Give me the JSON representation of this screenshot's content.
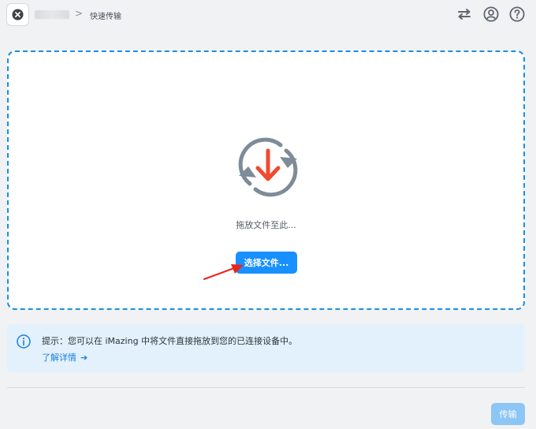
{
  "header": {
    "breadcrumb_separator": ">",
    "page_title": "快速传输",
    "icons": [
      "close-icon",
      "transfer-arrows-icon",
      "account-icon",
      "help-icon"
    ]
  },
  "drop_zone": {
    "hint": "拖放文件至此...",
    "choose_button_label": "选择文件...",
    "border_color": "#1a8fe3",
    "icon_colors": {
      "arrow": "#f04a2e",
      "ring": "#7e8b98"
    }
  },
  "tip": {
    "text": "提示：您可以在 iMazing 中将文件直接拖放到您的已连接设备中。",
    "link_label": "了解详情",
    "link_arrow": "➔"
  },
  "footer": {
    "transfer_button_label": "传输"
  },
  "colors": {
    "accent": "#1890ff",
    "disabled_button": "#8cc6f5",
    "tip_background": "#e2f1fc",
    "annotation_arrow": "#e8261c"
  }
}
